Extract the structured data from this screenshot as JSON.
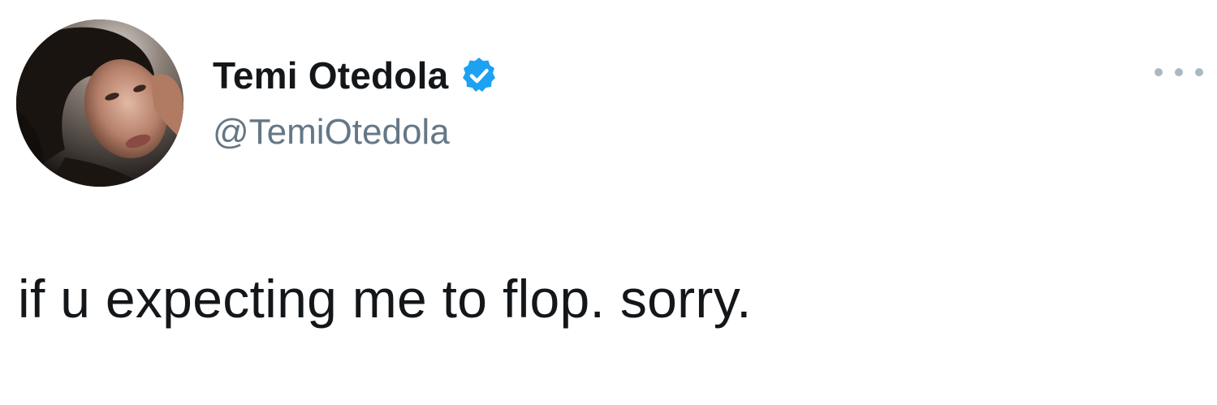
{
  "tweet": {
    "author": {
      "display_name": "Temi Otedola",
      "handle": "@TemiOtedola",
      "verified": true,
      "avatar_icon": "profile-photo",
      "verified_icon": "verified-badge-icon"
    },
    "more_icon": "more-options-icon",
    "text": "if u expecting me to flop. sorry."
  },
  "colors": {
    "name": "#14171a",
    "handle": "#657786",
    "verified": "#1da1f2",
    "more_dots": "#aab8c2",
    "background": "#ffffff"
  }
}
